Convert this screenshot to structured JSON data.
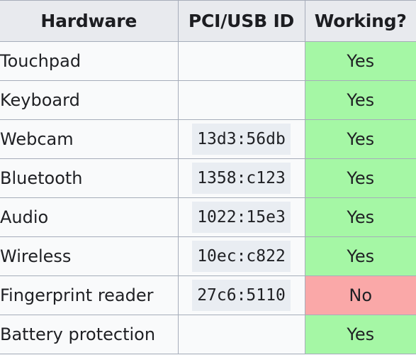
{
  "table": {
    "columns": [
      {
        "key": "hardware",
        "label": "Hardware",
        "align": "center"
      },
      {
        "key": "pci_usb_id",
        "label": "PCI/USB ID",
        "align": "center"
      },
      {
        "key": "working",
        "label": "Working?",
        "align": "center"
      }
    ],
    "rows": [
      {
        "hardware": "Touchpad",
        "pci_usb_id": "",
        "working": "Yes",
        "status": "yes"
      },
      {
        "hardware": "Keyboard",
        "pci_usb_id": "",
        "working": "Yes",
        "status": "yes"
      },
      {
        "hardware": "Webcam",
        "pci_usb_id": "13d3:56db",
        "working": "Yes",
        "status": "yes"
      },
      {
        "hardware": "Bluetooth",
        "pci_usb_id": "1358:c123",
        "working": "Yes",
        "status": "yes"
      },
      {
        "hardware": "Audio",
        "pci_usb_id": "1022:15e3",
        "working": "Yes",
        "status": "yes"
      },
      {
        "hardware": "Wireless",
        "pci_usb_id": "10ec:c822",
        "working": "Yes",
        "status": "yes"
      },
      {
        "hardware": "Fingerprint reader",
        "pci_usb_id": "27c6:5110",
        "working": "No",
        "status": "no"
      },
      {
        "hardware": "Battery protection",
        "pci_usb_id": "",
        "working": "Yes",
        "status": "yes"
      }
    ]
  },
  "colors": {
    "header_background": "#e8eaee",
    "body_background": "#f9fafb",
    "border": "#a6adba",
    "code_background": "#e9edf2",
    "status_yes_background": "#a5f7a5",
    "status_no_background": "#faa8a8",
    "text": "#1f2024"
  }
}
